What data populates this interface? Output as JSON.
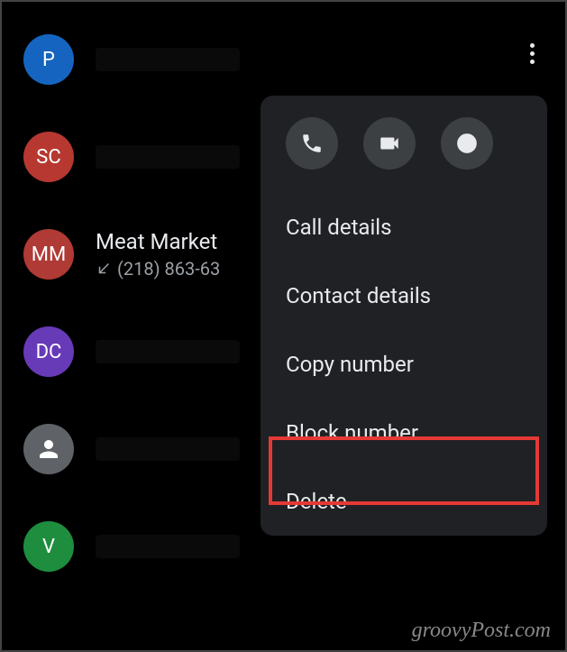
{
  "contacts": [
    {
      "initials": "P",
      "color": "avatar-blue",
      "name": "",
      "sub": ""
    },
    {
      "initials": "SC",
      "color": "avatar-red",
      "name": "",
      "sub": ""
    },
    {
      "initials": "MM",
      "color": "avatar-darkred",
      "name": "Meat Market",
      "sub": "(218) 863-63"
    },
    {
      "initials": "DC",
      "color": "avatar-purple",
      "name": "",
      "sub": ""
    },
    {
      "initials": "",
      "color": "avatar-gray",
      "name": "",
      "sub": "",
      "icon": "person"
    },
    {
      "initials": "V",
      "color": "avatar-green",
      "name": "",
      "sub": ""
    }
  ],
  "menu": {
    "call_details": "Call details",
    "contact_details": "Contact details",
    "copy_number": "Copy number",
    "block_number": "Block number",
    "delete": "Delete"
  },
  "watermark": "groovyPost.com"
}
